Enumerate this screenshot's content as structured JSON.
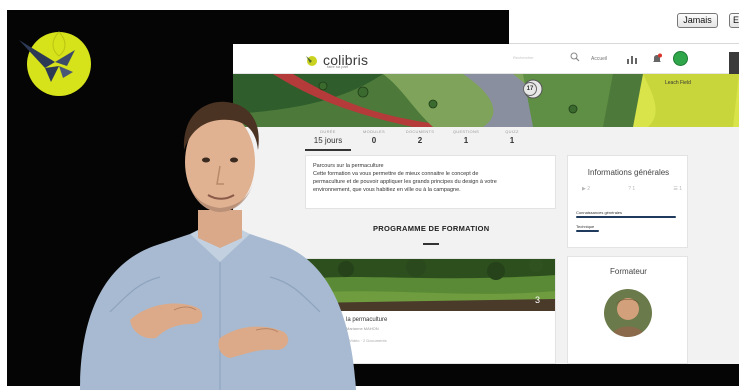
{
  "notification_bar": {
    "never_button": "Jamais",
    "other_button_partial": "E"
  },
  "site": {
    "brand": {
      "name": "colibris",
      "tagline": "faire sa part",
      "logo_color": "#c9d21f"
    },
    "nav": {
      "search_placeholder": "Rechercher",
      "link_label": "Accueil"
    },
    "banner": {
      "marker_number": "17",
      "map_label": "Leach Field"
    },
    "stats": [
      {
        "label": "DURÉE",
        "value": "15 jours",
        "active": true
      },
      {
        "label": "MODULES",
        "value": "0",
        "active": false
      },
      {
        "label": "DOCUMENTS",
        "value": "2",
        "active": false
      },
      {
        "label": "QUESTIONS",
        "value": "1",
        "active": false
      },
      {
        "label": "QUIZZ",
        "value": "1",
        "active": false
      }
    ],
    "description": {
      "title": "Parcours sur la permaculture",
      "lines": [
        "Cette formation va vous permettre de mieux connaitre le concept de",
        "permaculture et de pouvoir appliquer les grands principes du design à votre",
        "environnement, que vous habitiez en ville ou à la campagne."
      ]
    },
    "program": {
      "heading": "PROGRAMME DE FORMATION"
    },
    "course": {
      "title": "la permaculture",
      "author": "Marianne MAHON",
      "meta": "0 Vidéo · 2 Documents",
      "badge_number": "3"
    },
    "info": {
      "title": "Informations générales",
      "icons": [
        {
          "name": "video-icon",
          "value": "2"
        },
        {
          "name": "question-icon",
          "value": "1"
        },
        {
          "name": "list-icon",
          "value": "1"
        }
      ],
      "skills": [
        {
          "label": "Connaissances générales",
          "level": 0.95
        },
        {
          "label": "Technique",
          "level": 0.22
        }
      ],
      "bar_color": "#1f3a5c"
    },
    "trainer": {
      "title": "Formateur"
    }
  }
}
